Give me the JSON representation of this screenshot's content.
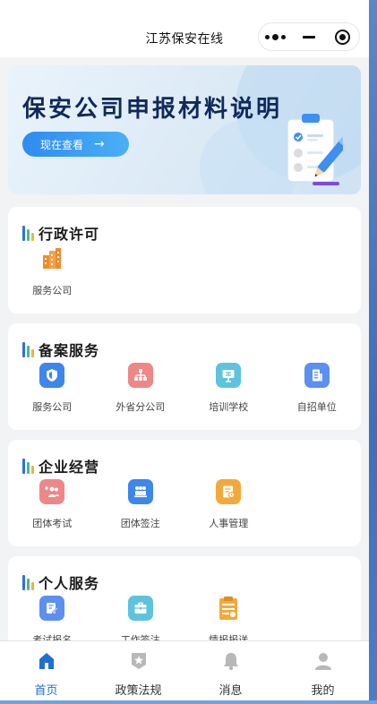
{
  "header": {
    "title": "江苏保安在线",
    "capsule": {
      "more_icon": "more-dots-icon",
      "minimize_icon": "minus-icon",
      "close_icon": "target-circle-icon"
    }
  },
  "banner": {
    "title": "保安公司申报材料说明",
    "button_label": "现在查看",
    "button_arrow": "→",
    "illustration": "clipboard-pencil-icon"
  },
  "sections": [
    {
      "title": "行政许可",
      "items": [
        {
          "label": "服务公司",
          "icon": "building-icon",
          "color": "#f08b2a"
        }
      ]
    },
    {
      "title": "备案服务",
      "items": [
        {
          "label": "服务公司",
          "icon": "shield-icon",
          "color": "#3d86ea"
        },
        {
          "label": "外省分公司",
          "icon": "org-chart-icon",
          "color": "#ef8787"
        },
        {
          "label": "培训学校",
          "icon": "signboard-icon",
          "color": "#5ec3de"
        },
        {
          "label": "自招单位",
          "icon": "office-building-icon",
          "color": "#5b8ff0"
        }
      ]
    },
    {
      "title": "企业经营",
      "items": [
        {
          "label": "团体考试",
          "icon": "add-group-icon",
          "color": "#ef8787"
        },
        {
          "label": "团体签注",
          "icon": "people-group-icon",
          "color": "#3d86ea"
        },
        {
          "label": "人事管理",
          "icon": "personnel-card-icon",
          "color": "#f3a93a"
        }
      ]
    },
    {
      "title": "个人服务",
      "items": [
        {
          "label": "考试报名",
          "icon": "edit-form-icon",
          "color": "#5b8ff0"
        },
        {
          "label": "工作签注",
          "icon": "briefcase-icon",
          "color": "#5ec3de"
        },
        {
          "label": "情报报送",
          "icon": "report-clipboard-icon",
          "color": "#f3a93a"
        }
      ]
    }
  ],
  "tabbar": [
    {
      "label": "首页",
      "icon": "home-icon",
      "active": true
    },
    {
      "label": "政策法规",
      "icon": "policy-badge-icon",
      "active": false
    },
    {
      "label": "消息",
      "icon": "bell-icon",
      "active": false
    },
    {
      "label": "我的",
      "icon": "user-icon",
      "active": false
    }
  ],
  "colors": {
    "accent": "#1f6fd1",
    "title_dark": "#10295a"
  }
}
